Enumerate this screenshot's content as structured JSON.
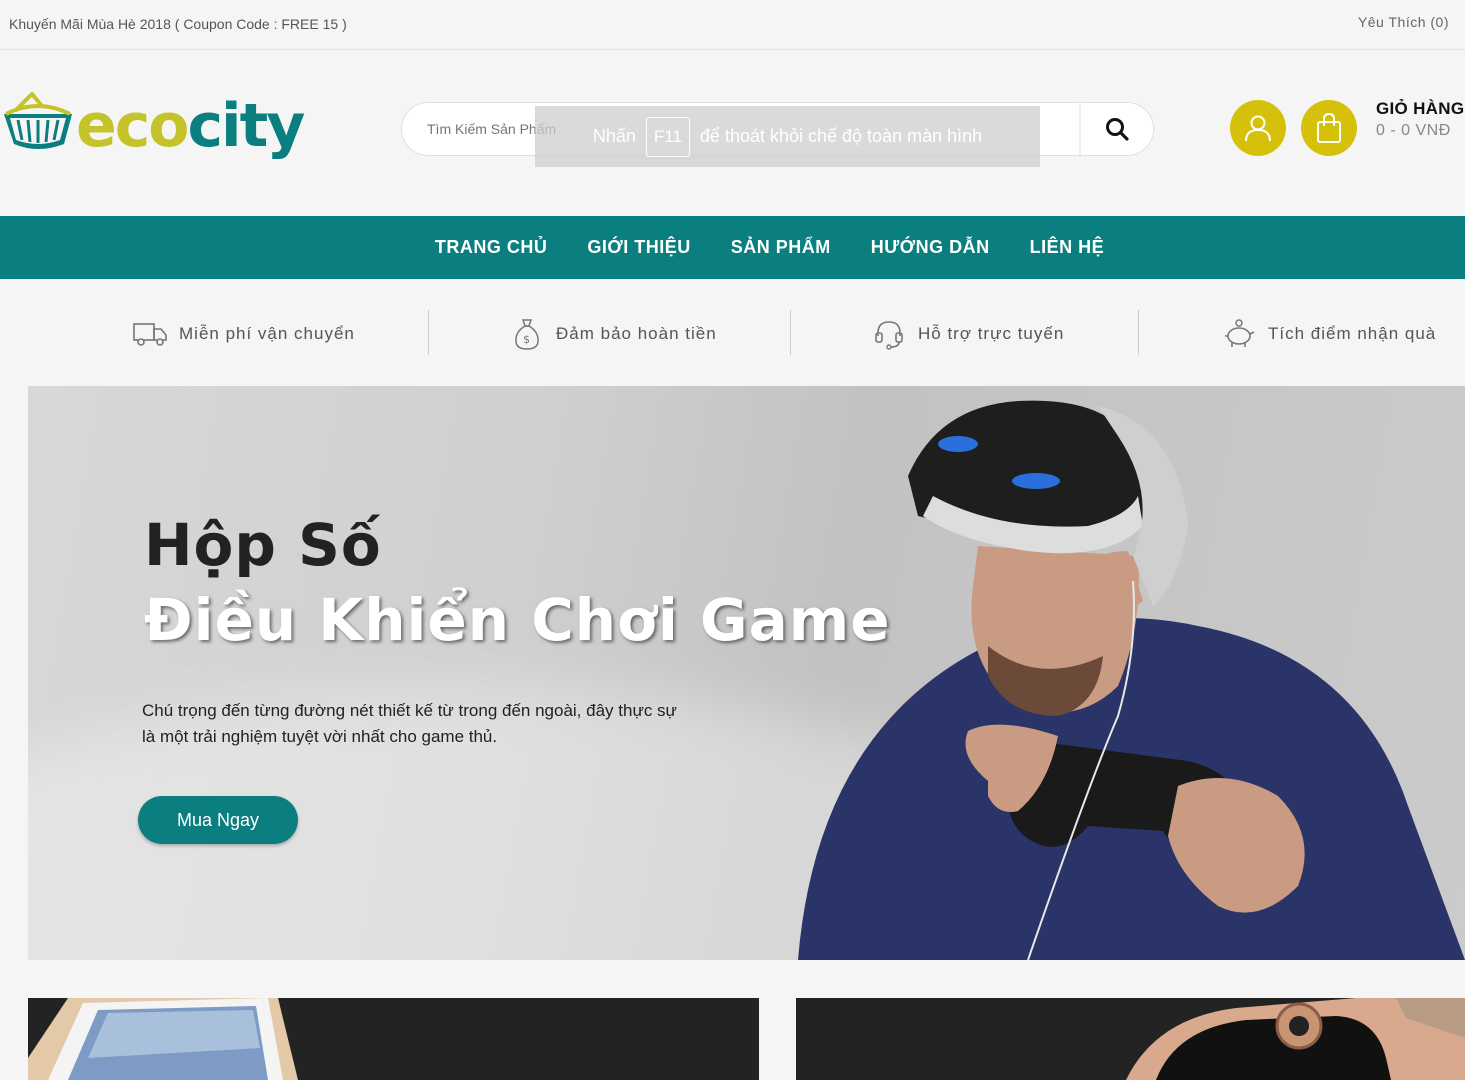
{
  "topbar": {
    "promo": "Khuyến Mãi Mùa Hè 2018 ( Coupon Code : FREE 15 )",
    "wishlist": "Yêu Thích (0)"
  },
  "header": {
    "logo_part1": "eco",
    "logo_part2": "city",
    "search_placeholder": "Tìm Kiếm Sản Phẩm",
    "cart_title": "GIỎ HÀNG",
    "cart_total": "0 - 0 VNĐ"
  },
  "fullscreen_notice": {
    "before": "Nhấn",
    "key": "F11",
    "after": "để thoát khỏi chế độ toàn màn hình"
  },
  "nav": {
    "items": [
      "TRANG CHỦ",
      "GIỚI THIỆU",
      "SẢN PHẨM",
      "HƯỚNG DẪN",
      "LIÊN HỆ"
    ]
  },
  "features": [
    {
      "label": "Miễn phí vận chuyển",
      "icon": "truck-icon"
    },
    {
      "label": "Đảm bảo hoàn tiền",
      "icon": "money-bag-icon"
    },
    {
      "label": "Hỗ trợ trực tuyến",
      "icon": "headset-icon"
    },
    {
      "label": "Tích điểm nhận quà",
      "icon": "piggy-bank-icon"
    }
  ],
  "banner": {
    "title_line1": "Hộp Số",
    "title_line2": "Điều Khiển Chơi Game",
    "description": "Chú trọng đến từng đường nét thiết kế từ trong đến ngoài, đây thực sự là một trải nghiệm tuyệt vời nhất cho game thủ.",
    "button": "Mua Ngay"
  },
  "colors": {
    "primary": "#0b7f7f",
    "accent": "#d6c10a",
    "logo_eco": "#c5c32a"
  }
}
